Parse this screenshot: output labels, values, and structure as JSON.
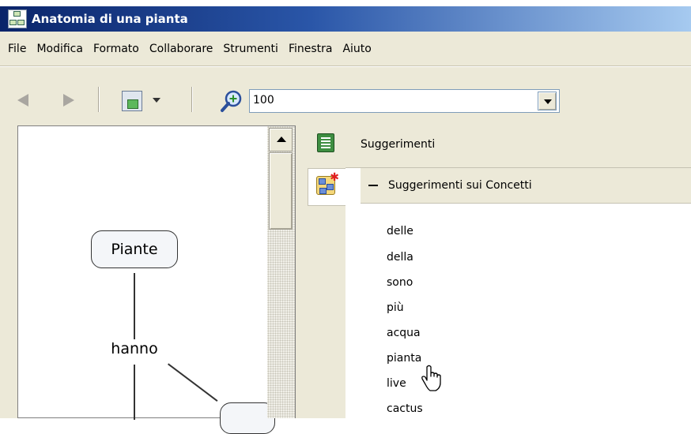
{
  "window": {
    "title": "Anatomia di una pianta"
  },
  "menu": [
    "File",
    "Modifica",
    "Formato",
    "Collaborare",
    "Strumenti",
    "Finestra",
    "Aiuto"
  ],
  "toolbar": {
    "zoom_value": "100"
  },
  "concept_map": {
    "concepts": [
      "Piante"
    ],
    "links": [
      "hanno"
    ]
  },
  "suggestions": {
    "panel_title": "Suggerimenti",
    "section_title": "Suggerimenti sui Concetti",
    "words": [
      "delle",
      "della",
      "sono",
      "più",
      "acqua",
      "pianta",
      "live",
      "cactus"
    ]
  },
  "colors": {
    "title_bar": "#0a246a",
    "chrome": "#ece9d8",
    "book_icon": "#3e8e41"
  }
}
